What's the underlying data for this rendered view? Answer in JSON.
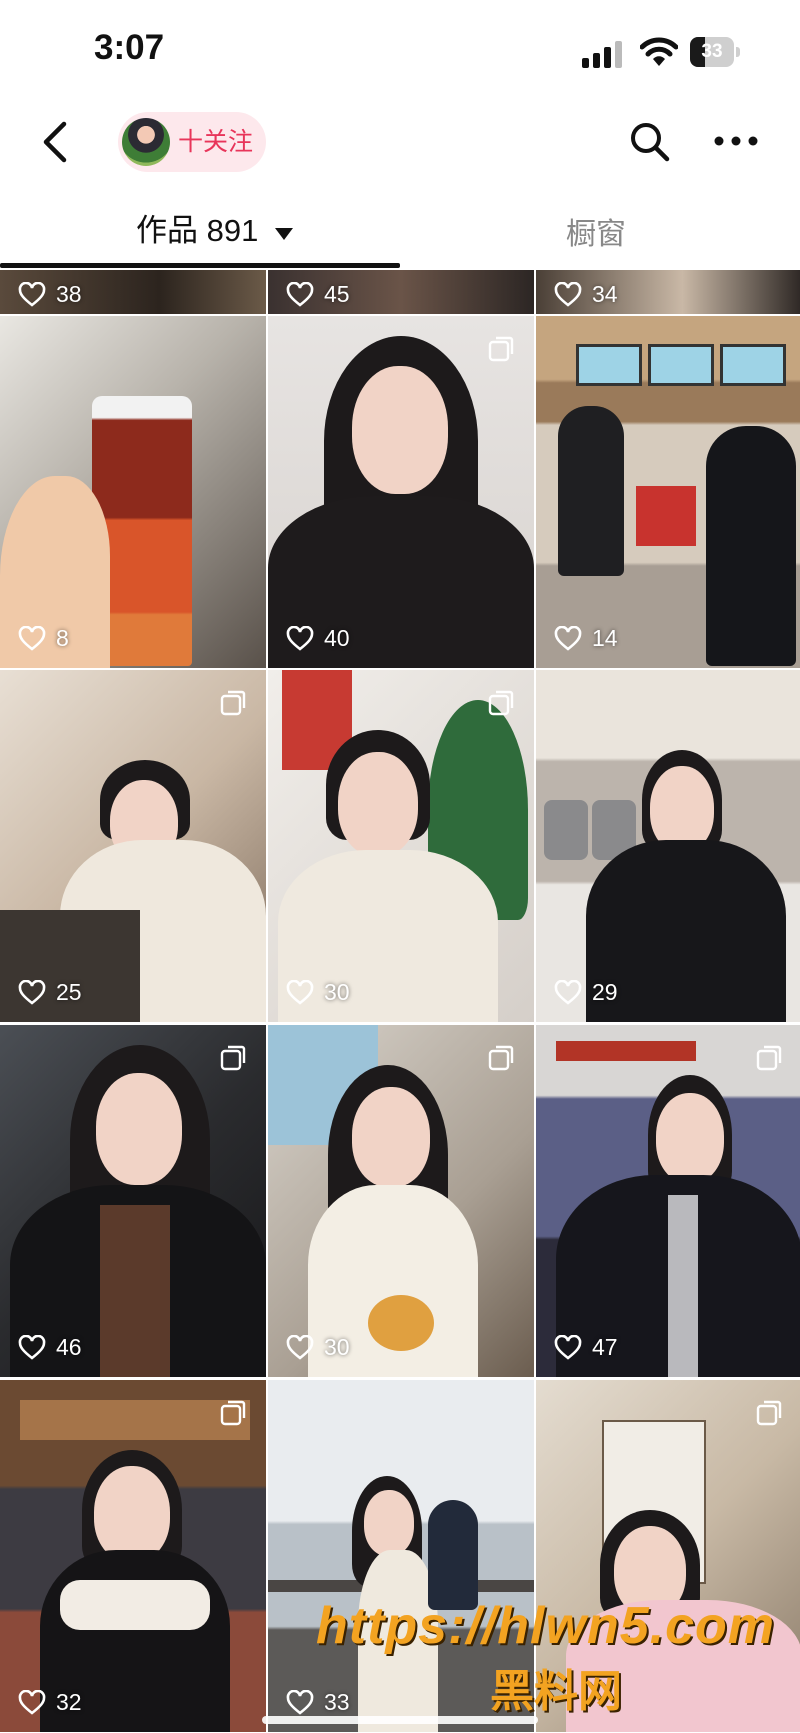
{
  "status_bar": {
    "time": "3:07",
    "battery": "33",
    "battery_level": 0.33
  },
  "header": {
    "follow_label": "十关注"
  },
  "tabs": {
    "works_label": "作品 891",
    "showcase_label": "橱窗"
  },
  "grid": {
    "top_row_likes": [
      "38",
      "45",
      "34"
    ],
    "items": [
      {
        "likes": "8",
        "multi": false
      },
      {
        "likes": "40",
        "multi": true
      },
      {
        "likes": "14",
        "multi": false
      },
      {
        "likes": "25",
        "multi": true
      },
      {
        "likes": "30",
        "multi": true
      },
      {
        "likes": "29",
        "multi": false
      },
      {
        "likes": "46",
        "multi": true
      },
      {
        "likes": "30",
        "multi": true
      },
      {
        "likes": "47",
        "multi": true
      },
      {
        "likes": "32",
        "multi": true
      },
      {
        "likes": "33",
        "multi": false
      },
      {
        "likes": "",
        "multi": true
      }
    ]
  },
  "watermark": {
    "url": "https://hlwn5.com",
    "name": "黑料网"
  },
  "colors": {
    "accent": "#e8355a",
    "follow_bg": "#fde8ec",
    "watermark": "#f3a321"
  }
}
